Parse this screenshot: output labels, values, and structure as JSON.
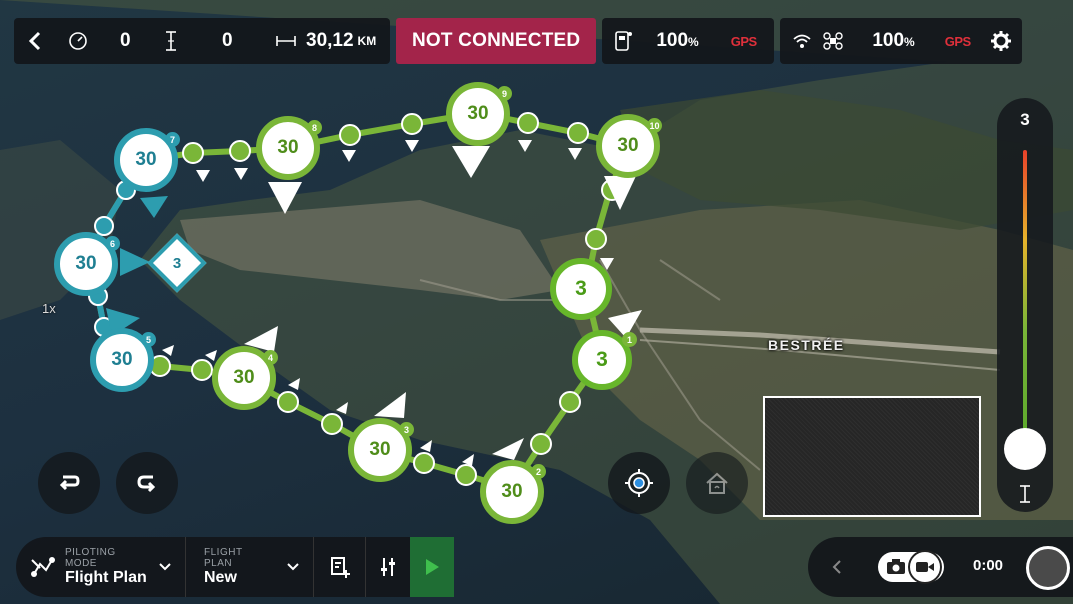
{
  "topbar": {
    "back_icon": "chevron-left-icon",
    "speed": {
      "icon": "speedometer-icon",
      "value": "0"
    },
    "altitude": {
      "icon": "altitude-icon",
      "value": "0"
    },
    "distance": {
      "icon": "distance-icon",
      "value": "30,12",
      "unit": "KM"
    },
    "connection_status": "NOT CONNECTED",
    "controller": {
      "icon": "controller-battery-icon",
      "battery": "100",
      "unit": "%",
      "gps": "GPS"
    },
    "drone": {
      "wifi_icon": "wifi-icon",
      "icon": "drone-battery-icon",
      "battery": "100",
      "unit": "%",
      "gps": "GPS"
    },
    "settings_icon": "gear-icon"
  },
  "map": {
    "place_label": "BESTRÉE",
    "zoom_label": "1x",
    "waypoints": [
      {
        "index": "1",
        "value": "3",
        "style": "green3"
      },
      {
        "index": "",
        "value": "3",
        "style": "green3"
      },
      {
        "index": "2",
        "value": "30",
        "style": "green"
      },
      {
        "index": "3",
        "value": "30",
        "style": "green"
      },
      {
        "index": "4",
        "value": "30",
        "style": "green"
      },
      {
        "index": "5",
        "value": "30",
        "style": "teal"
      },
      {
        "index": "6",
        "value": "30",
        "style": "teal"
      },
      {
        "index": "7",
        "value": "30",
        "style": "teal"
      },
      {
        "index": "8",
        "value": "30",
        "style": "green"
      },
      {
        "index": "9",
        "value": "30",
        "style": "green"
      },
      {
        "index": "10",
        "value": "30",
        "style": "green"
      }
    ],
    "poi_value": "3"
  },
  "altitude_slider": {
    "value": "3",
    "icon": "altitude-icon"
  },
  "map_buttons": {
    "undo_icon": "undo-icon",
    "redo_icon": "redo-icon",
    "locate_icon": "locate-target-icon",
    "home_icon": "home-icon"
  },
  "bottombar": {
    "piloting_mode_label": "PILOTING MODE",
    "piloting_mode_value": "Flight Plan",
    "flight_plan_label": "FLIGHT PLAN",
    "flight_plan_value": "New",
    "edit_icon": "edit-plan-icon",
    "settings_icon": "sliders-icon",
    "play_icon": "play-icon"
  },
  "recording": {
    "time": "0:00",
    "photo_icon": "camera-icon",
    "video_icon": "video-icon"
  },
  "colors": {
    "accent_green": "#7ab638",
    "accent_teal": "#2d9daf",
    "alert": "#a3244a",
    "gps_red": "#e0303b"
  }
}
